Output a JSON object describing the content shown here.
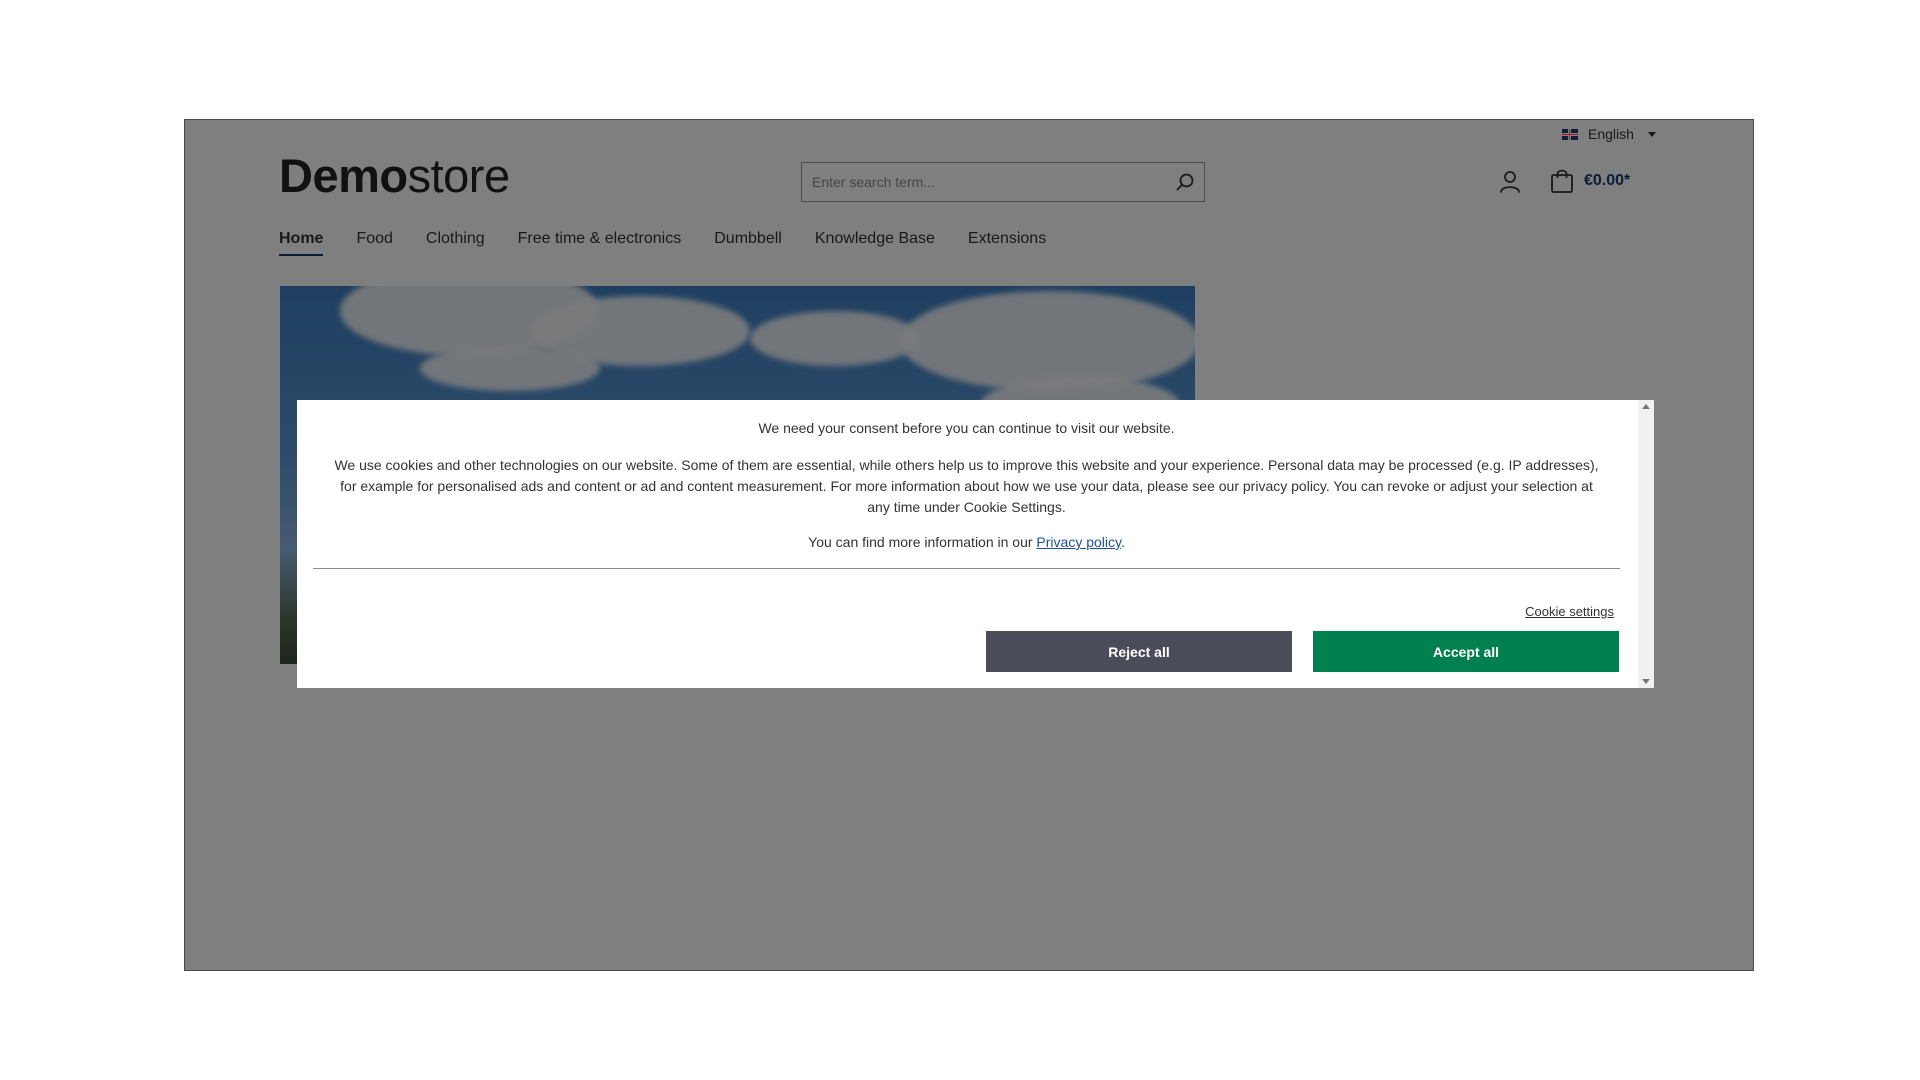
{
  "header": {
    "language": "English",
    "logo_bold": "Demo",
    "logo_light": "store",
    "search_placeholder": "Enter search term...",
    "cart_total": "€0.00*"
  },
  "nav": {
    "items": [
      "Home",
      "Food",
      "Clothing",
      "Free time & electronics",
      "Dumbbell",
      "Knowledge Base",
      "Extensions"
    ],
    "active": "Home"
  },
  "cookie_modal": {
    "title": "We need your consent before you can continue to visit our website.",
    "body": "We use cookies and other technologies on our website. Some of them are essential, while others help us to improve this website and your experience. Personal data may be processed (e.g. IP addresses), for example for personalised ads and content or ad and content measurement. For more information about how we use your data, please see our privacy policy. You can revoke or adjust your selection at any time under Cookie Settings.",
    "more_info_prefix": "You can find more information in our ",
    "privacy_link": "Privacy policy",
    "more_info_suffix": ".",
    "cookie_settings": "Cookie settings",
    "reject_all": "Reject all",
    "accept_all": "Accept all"
  },
  "colors": {
    "accent": "#1b3a6b",
    "accept": "#00804f",
    "reject": "#4a4d58",
    "overlay": "rgba(0,0,0,0.5)"
  },
  "icons": [
    "search-icon",
    "account-icon",
    "cart-icon",
    "flag-uk-icon",
    "chevron-down-icon"
  ]
}
